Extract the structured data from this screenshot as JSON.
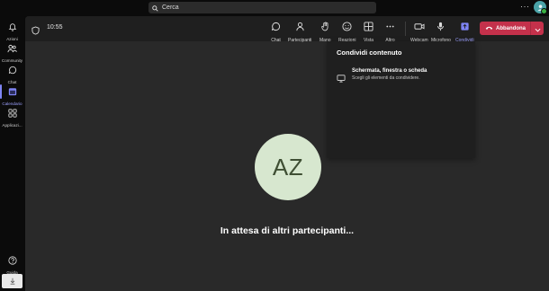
{
  "search": {
    "placeholder": "Cerca"
  },
  "titlebar": {
    "more": "···"
  },
  "rail": {
    "items": [
      {
        "label": "Azioni",
        "icon": "bell-icon"
      },
      {
        "label": "Community",
        "icon": "people-icon"
      },
      {
        "label": "Chat",
        "icon": "chat-icon"
      },
      {
        "label": "Calendario",
        "icon": "calendar-icon",
        "active": true
      },
      {
        "label": "Applicazi...",
        "icon": "apps-icon"
      }
    ],
    "help": {
      "label": "Guida",
      "icon": "help-icon"
    }
  },
  "meeting": {
    "timer": "10:55",
    "toolbar": {
      "chat": "Chat",
      "people": "Partecipanti",
      "raise": "Mano",
      "react": "Reazioni",
      "view": "Vista",
      "more": "Altro",
      "camera": "Webcam",
      "mic": "Microfono",
      "share": "Condividi"
    },
    "leave_label": "Abbandona",
    "avatar_initials": "AZ",
    "waiting_text": "In attesa di altri partecipanti..."
  },
  "share_panel": {
    "title": "Condividi contenuto",
    "option_title": "Schermata, finestra o scheda",
    "option_subtitle": "Scegli gli elementi da condividere."
  },
  "colors": {
    "accent": "#7f85f5",
    "leave": "#c4314b",
    "avatar_bg": "#d7e7cf",
    "stage_bg": "#292929"
  }
}
